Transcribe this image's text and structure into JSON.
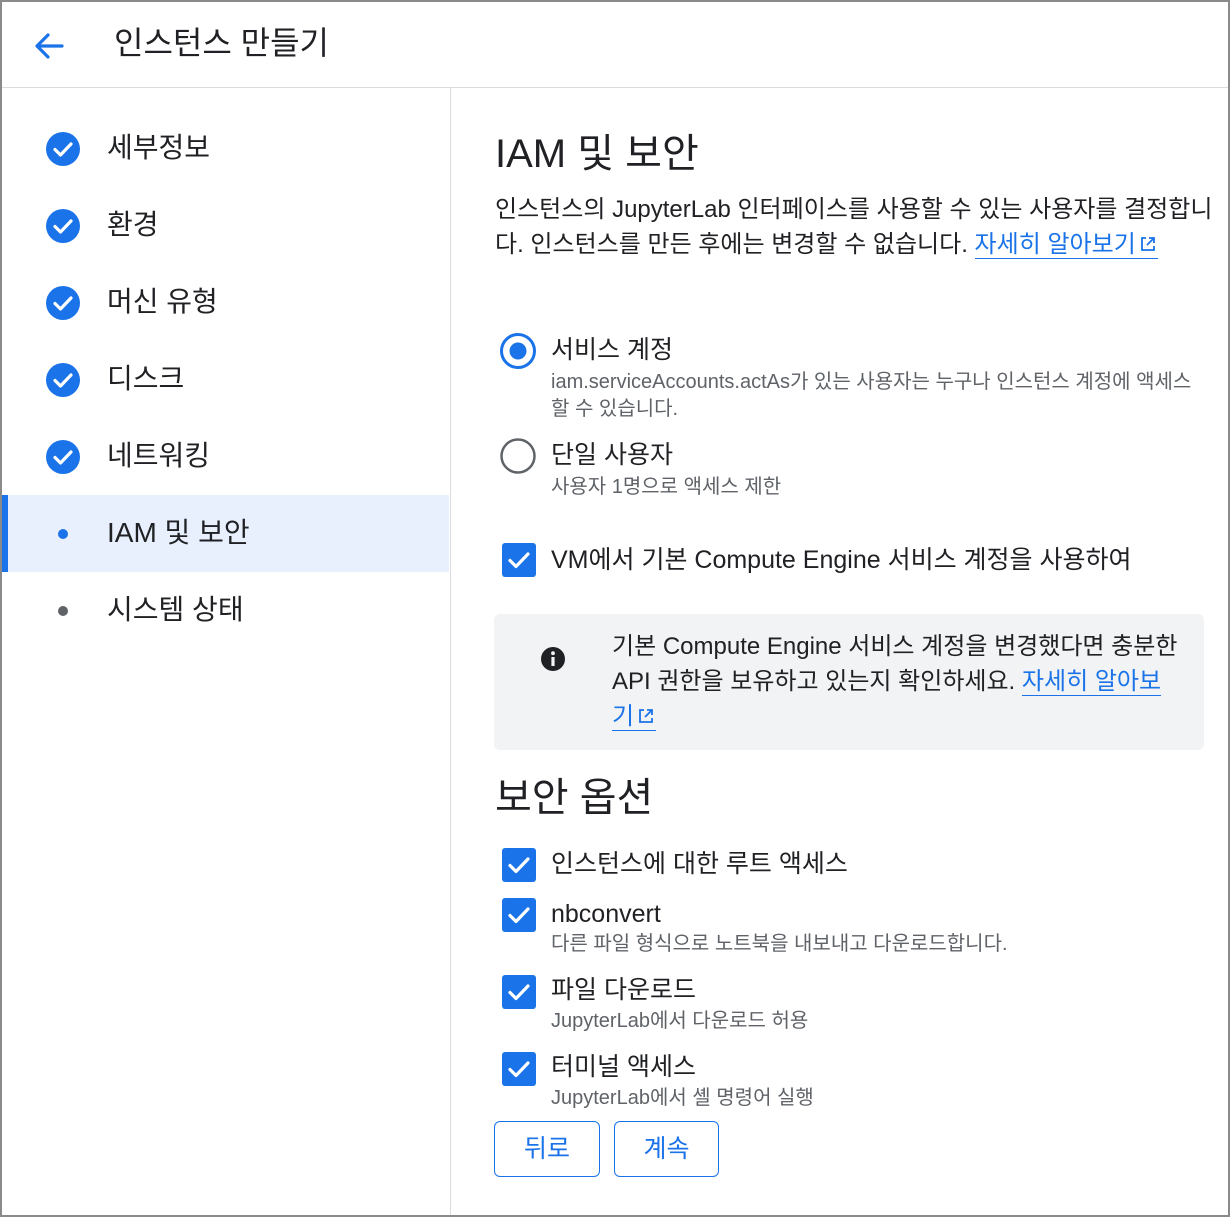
{
  "header": {
    "back_icon": "arrow-left-icon",
    "title": "인스턴스 만들기"
  },
  "colors": {
    "accent": "#1a73e8",
    "text": "#202124",
    "secondary": "#5f6368",
    "active_bg": "#e8f0fe",
    "info_bg": "#f1f3f4"
  },
  "steps": [
    {
      "label": "세부정보",
      "state": "done"
    },
    {
      "label": "환경",
      "state": "done"
    },
    {
      "label": "머신 유형",
      "state": "done"
    },
    {
      "label": "디스크",
      "state": "done"
    },
    {
      "label": "네트워킹",
      "state": "done"
    },
    {
      "label": "IAM 및 보안",
      "state": "active"
    },
    {
      "label": "시스템 상태",
      "state": "pending"
    }
  ],
  "main": {
    "title": "IAM 및 보안",
    "description": "인스턴스의 JupyterLab 인터페이스를 사용할 수 있는 사용자를 결정합니다. 인스턴스를 만든 후에는 변경할 수 없습니다.",
    "learn_more": "자세히 알아보기",
    "access_options": [
      {
        "title": "서비스 계정",
        "subtitle": "iam.serviceAccounts.actAs가 있는 사용자는 누구나 인스턴스 계정에 액세스할 수 있습니다.",
        "selected": true
      },
      {
        "title": "단일 사용자",
        "subtitle": "사용자 1명으로 액세스 제한",
        "selected": false
      }
    ],
    "default_sa_checkbox": {
      "label": "VM에서 기본 Compute Engine 서비스 계정을 사용하여",
      "checked": true
    },
    "info_box": {
      "text": "기본 Compute Engine 서비스 계정을 변경했다면 충분한 API 권한을 보유하고 있는지 확인하세요.",
      "link": "자세히 알아보기"
    },
    "security_title": "보안 옵션",
    "security_options": [
      {
        "label": "인스턴스에 대한 루트 액세스",
        "subtitle": "",
        "checked": true
      },
      {
        "label": "nbconvert",
        "subtitle": "다른 파일 형식으로 노트북을 내보내고 다운로드합니다.",
        "checked": true
      },
      {
        "label": "파일 다운로드",
        "subtitle": "JupyterLab에서 다운로드 허용",
        "checked": true
      },
      {
        "label": "터미널 액세스",
        "subtitle": "JupyterLab에서 셸 명령어 실행",
        "checked": true
      }
    ],
    "buttons": {
      "back": "뒤로",
      "continue": "계속"
    }
  }
}
